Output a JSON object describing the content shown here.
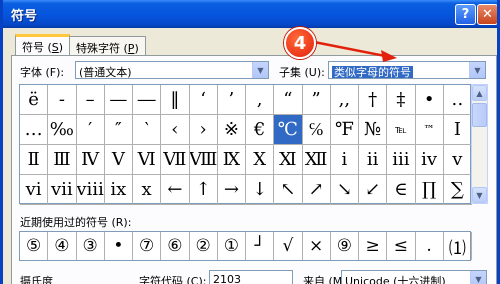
{
  "window": {
    "title": "符号",
    "help_label": "?",
    "close_label": "✕"
  },
  "tabs": [
    {
      "label_prefix": "符号 (",
      "mnemonic": "S",
      "label_suffix": ")"
    },
    {
      "label_prefix": "特殊字符 (",
      "mnemonic": "P",
      "label_suffix": ")"
    }
  ],
  "font": {
    "label": "字体 (F):",
    "value": "(普通文本)"
  },
  "subset": {
    "label": "子集 (U):",
    "value": "类似字母的符号"
  },
  "annotation": {
    "number": "4",
    "color": "#e3200b"
  },
  "symbol_grid": [
    [
      "ë",
      "-",
      "–",
      "—",
      "―",
      "‖",
      "‘",
      "’",
      ",",
      "“",
      "”",
      ",,",
      "†",
      "‡",
      "•",
      "‥"
    ],
    [
      "…",
      "‰",
      "′",
      "″",
      "‵",
      "‹",
      "›",
      "※",
      "€",
      "℃",
      "℅",
      "℉",
      "№",
      "℡",
      "™",
      "Ⅰ"
    ],
    [
      "Ⅱ",
      "Ⅲ",
      "Ⅳ",
      "Ⅴ",
      "Ⅵ",
      "Ⅶ",
      "Ⅷ",
      "Ⅸ",
      "Ⅹ",
      "Ⅺ",
      "Ⅻ",
      "ⅰ",
      "ⅱ",
      "ⅲ",
      "ⅳ",
      "ⅴ"
    ],
    [
      "ⅵ",
      "ⅶ",
      "ⅷ",
      "ⅸ",
      "ⅹ",
      "←",
      "↑",
      "→",
      "↓",
      "↖",
      "↗",
      "↘",
      "↙",
      "∈",
      "∏",
      "∑"
    ]
  ],
  "selected_symbol": "℃",
  "recent": {
    "label": "近期使用过的符号 (R):",
    "symbols": [
      "⑤",
      "④",
      "③",
      "•",
      "⑦",
      "⑥",
      "②",
      "①",
      "┘",
      "√",
      "×",
      "⑨",
      "≥",
      "≤",
      ".",
      "⑴"
    ]
  },
  "footer": {
    "char_name": "摄氏度",
    "code_label": "字符代码 (C):",
    "code_value": "2103",
    "from_label": "来自 (M):",
    "from_value": "Unicode (十六进制)"
  }
}
